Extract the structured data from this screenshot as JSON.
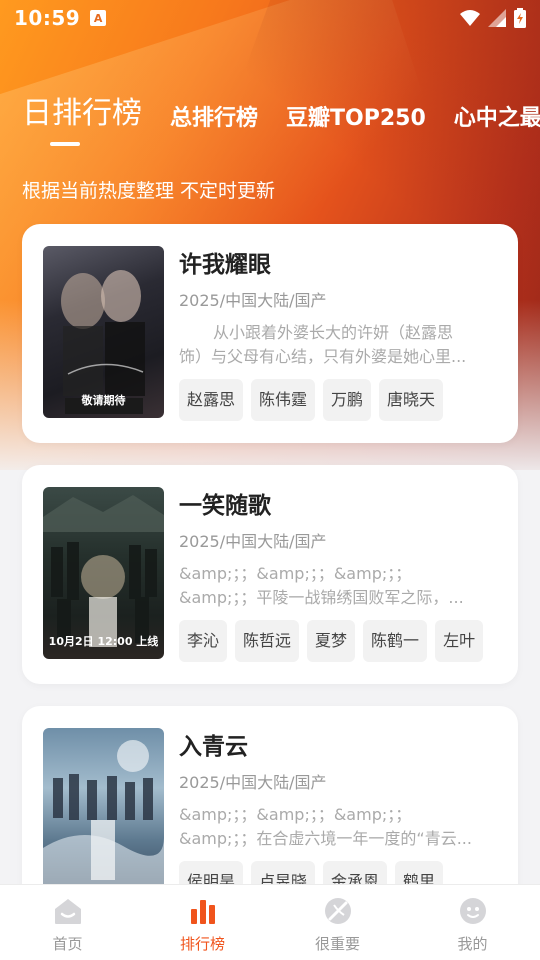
{
  "status_bar": {
    "time": "10:59",
    "notification_glyph": "A"
  },
  "tabs": [
    {
      "label": "日排行榜",
      "active": true
    },
    {
      "label": "总排行榜",
      "active": false
    },
    {
      "label": "豆瓣TOP250",
      "active": false
    },
    {
      "label": "心中之最",
      "active": false
    }
  ],
  "subtitle": "根据当前热度整理 不定时更新",
  "items": [
    {
      "title": "许我耀眼",
      "meta": "2025/中国大陆/国产",
      "desc_line1": "从小跟着外婆长大的许妍（赵露思",
      "desc_line2": "饰）与父母有心结，只有外婆是她心里...",
      "tags": [
        "赵露思",
        "陈伟霆",
        "万鹏",
        "唐晓天"
      ],
      "poster_label": "敬请期待"
    },
    {
      "title": "一笑随歌",
      "meta": "2025/中国大陆/国产",
      "desc_line1": "&amp;；；&amp;；；&amp;；；",
      "desc_line2": "&amp;；；平陵一战锦绣国败军之际，...",
      "tags": [
        "李沁",
        "陈哲远",
        "夏梦",
        "陈鹤一",
        "左叶"
      ],
      "poster_label": "10月2日 12:00 上线"
    },
    {
      "title": "入青云",
      "meta": "2025/中国大陆/国产",
      "desc_line1": "&amp;；；&amp;；；&amp;；；",
      "desc_line2": "&amp;；；在合虚六境一年一度的“青云...",
      "tags": [
        "侯明昊",
        "卢昱晓",
        "金承恩",
        "鹤里"
      ],
      "poster_label": ""
    }
  ],
  "bottom_nav": [
    {
      "label": "首页",
      "icon": "home-icon",
      "active": false
    },
    {
      "label": "排行榜",
      "icon": "ranking-icon",
      "active": true
    },
    {
      "label": "很重要",
      "icon": "important-icon",
      "active": false
    },
    {
      "label": "我的",
      "icon": "profile-icon",
      "active": false
    }
  ],
  "colors": {
    "accent": "#f0541c",
    "hero_start": "#ff9a1f",
    "hero_end": "#8f2418"
  }
}
